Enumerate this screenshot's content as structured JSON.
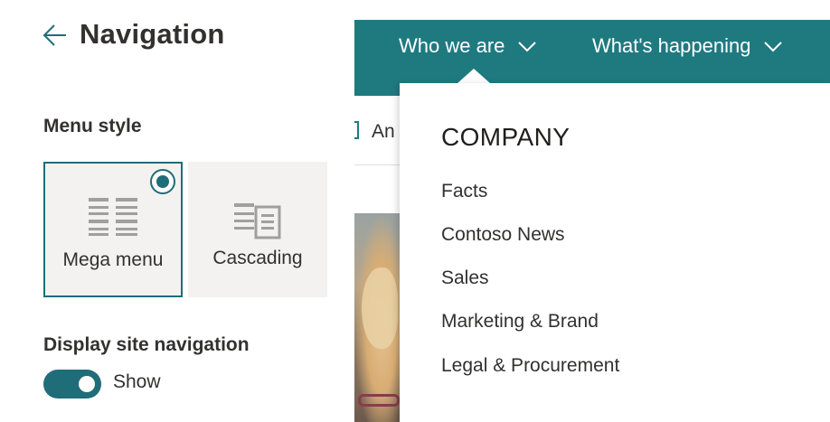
{
  "panel": {
    "title": "Navigation",
    "back_icon": "arrow-left-icon",
    "menu_style_label": "Menu style",
    "options": [
      {
        "label": "Mega menu",
        "selected": true,
        "icon": "mega-menu-icon"
      },
      {
        "label": "Cascading",
        "selected": false,
        "icon": "cascading-icon"
      }
    ],
    "display_nav_label": "Display site navigation",
    "toggle": {
      "on": true,
      "label": "Show"
    }
  },
  "preview": {
    "nav": [
      {
        "label": "Who we are",
        "icon": "chevron-down-icon"
      },
      {
        "label": "What's happening",
        "icon": "chevron-down-icon"
      }
    ],
    "subbar_text": "An",
    "dropdown": {
      "heading": "COMPANY",
      "links": [
        "Facts",
        "Contoso News",
        "Sales",
        "Marketing & Brand",
        "Legal & Procurement"
      ]
    }
  },
  "colors": {
    "accent": "#1f6d78",
    "topbar": "#1f7a80",
    "option_bg": "#f3f2f1",
    "text": "#323130"
  }
}
